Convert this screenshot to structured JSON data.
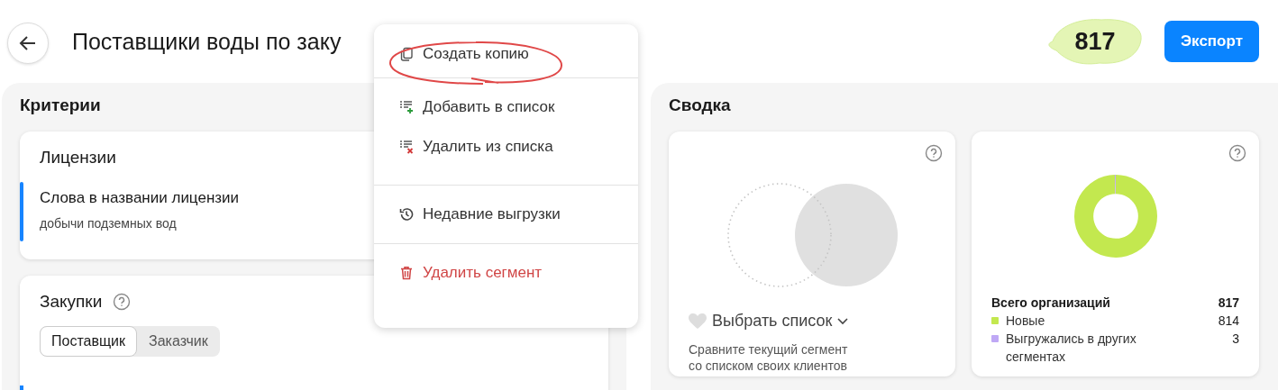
{
  "header": {
    "title": "Поставщики воды по заку",
    "count": "817",
    "export_button": "Экспорт"
  },
  "criteria": {
    "title": "Критерии",
    "licenses": {
      "title": "Лицензии",
      "field_label": "Слова в названии лицензии",
      "field_value": "добычи подземных вод"
    },
    "purchases": {
      "title": "Закупки",
      "tabs": [
        {
          "label": "Поставщик",
          "selected": true
        },
        {
          "label": "Заказчик",
          "selected": false
        }
      ]
    }
  },
  "summary": {
    "title": "Сводка",
    "compare": {
      "select_label": "Выбрать список",
      "description": "Сравните текущий сегмент со списком своих клиентов"
    },
    "organizations": {
      "total_label": "Всего организаций",
      "total": "817",
      "legend": [
        {
          "label": "Новые",
          "value": "814",
          "color": "#c3e84f"
        },
        {
          "label": "Выгружались в других сегментах",
          "value": "3",
          "color": "#bfa8f5"
        }
      ]
    }
  },
  "menu": {
    "groups": [
      [
        {
          "label": "Создать копию",
          "kind": "copy"
        }
      ],
      [
        {
          "label": "Добавить в список",
          "kind": "add"
        },
        {
          "label": "Удалить из списка",
          "kind": "remove"
        }
      ],
      [
        {
          "label": "Недавние выгрузки",
          "kind": "history"
        }
      ],
      [
        {
          "label": "Удалить сегмент",
          "kind": "delete"
        }
      ]
    ]
  }
}
